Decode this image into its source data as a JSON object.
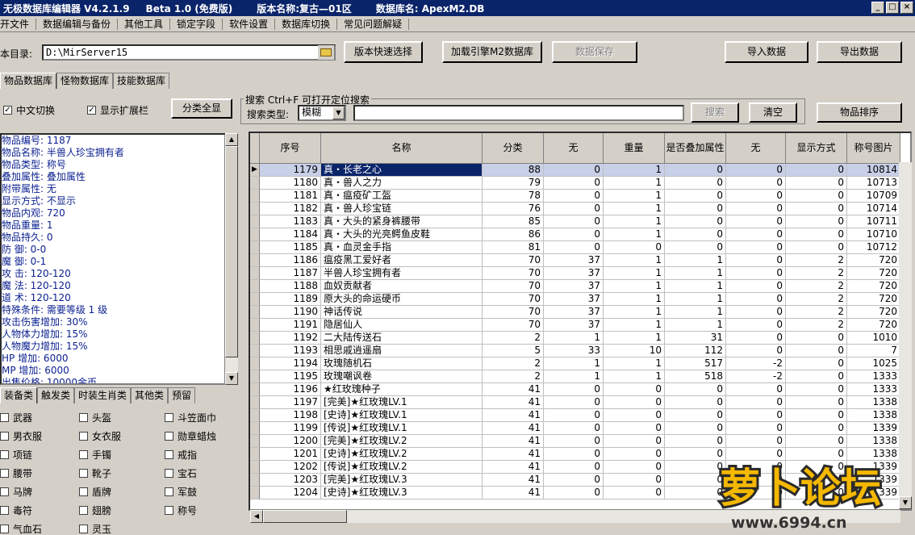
{
  "window": {
    "title_app": "无极数据库编辑器 V4.2.1.9",
    "title_edition": "Beta 1.0 (免费版)",
    "title_version": "版本名称:复古—01区",
    "title_db": "数据库名: ApexM2.DB"
  },
  "menu": [
    "开文件",
    "数据编辑与备份",
    "其他工具",
    "锁定字段",
    "软件设置",
    "数据库切换",
    "常见问题解疑"
  ],
  "toolbar": {
    "path_label": "本目录:",
    "path_value": "D:\\MirServer15",
    "quick_select": "版本快速选择",
    "load_engine": "加载引擎M2数据库",
    "save_data": "数据保存",
    "import": "导入数据",
    "export": "导出数据"
  },
  "tabs": [
    "物品数据库",
    "怪物数据库",
    "技能数据库"
  ],
  "options": {
    "chinese_toggle": "中文切换",
    "show_ext": "显示扩展栏",
    "expand_all": "分类全显"
  },
  "search": {
    "group_label": "搜索  Ctrl+F 可打开定位搜索",
    "type_label": "搜索类型:",
    "type_value": "模糊",
    "search_btn": "搜索",
    "clear_btn": "清空",
    "sort_btn": "物品排序"
  },
  "info_lines": [
    "物品编号: 1187",
    "物品名称: 半兽人珍宝拥有者",
    "物品类型: 称号",
    "叠加属性: 叠加属性",
    "附带属性: 无",
    "显示方式: 不显示",
    "物品内观: 720",
    "物品重量: 1",
    "物品持久: 0",
    "防    御: 0-0",
    "魔    御: 0-1",
    "攻    击: 120-120",
    "魔    法: 120-120",
    "道    术: 120-120",
    "特殊条件: 需要等级 1 级",
    "攻击伤害增加: 30%",
    "人物体力增加: 15%",
    "人物魔力增加: 15%",
    "HP  增加: 6000",
    "MP  增加: 6000",
    "出售价格: 10000金币"
  ],
  "cat_tabs": [
    "装备类",
    "触发类",
    "时装生肖类",
    "其他类",
    "预留"
  ],
  "categories": [
    [
      "武器",
      "头盔",
      "斗笠面巾"
    ],
    [
      "男衣服",
      "女衣服",
      "勋章蜡烛"
    ],
    [
      "项链",
      "手镯",
      "戒指"
    ],
    [
      "腰带",
      "靴子",
      "宝石"
    ],
    [
      "马牌",
      "盾牌",
      "军鼓"
    ],
    [
      "毒符",
      "翅膀",
      "称号"
    ],
    [
      "气血石",
      "灵玉",
      ""
    ]
  ],
  "grid": {
    "headers": [
      "序号",
      "名称",
      "分类",
      "无",
      "重量",
      "是否叠加属性",
      "无",
      "显示方式",
      "称号图片"
    ],
    "rows": [
      [
        "1179",
        "真・长老之心",
        "88",
        "0",
        "1",
        "0",
        "0",
        "0",
        "10814"
      ],
      [
        "1180",
        "真・兽人之力",
        "79",
        "0",
        "1",
        "0",
        "0",
        "0",
        "10713"
      ],
      [
        "1181",
        "真・瘟疫矿工盔",
        "78",
        "0",
        "1",
        "0",
        "0",
        "0",
        "10709"
      ],
      [
        "1182",
        "真・兽人珍宝链",
        "76",
        "0",
        "1",
        "0",
        "0",
        "0",
        "10714"
      ],
      [
        "1183",
        "真・大头的紧身裤腰带",
        "85",
        "0",
        "1",
        "0",
        "0",
        "0",
        "10711"
      ],
      [
        "1184",
        "真・大头的光亮鳄鱼皮鞋",
        "86",
        "0",
        "1",
        "0",
        "0",
        "0",
        "10710"
      ],
      [
        "1185",
        "真・血灵金手指",
        "81",
        "0",
        "0",
        "0",
        "0",
        "0",
        "10712"
      ],
      [
        "1186",
        "瘟疫黑工爱好者",
        "70",
        "37",
        "1",
        "1",
        "0",
        "2",
        "720"
      ],
      [
        "1187",
        "半兽人珍宝拥有者",
        "70",
        "37",
        "1",
        "1",
        "0",
        "2",
        "720"
      ],
      [
        "1188",
        "血奴贡献者",
        "70",
        "37",
        "1",
        "1",
        "0",
        "2",
        "720"
      ],
      [
        "1189",
        "原大头的命运硬币",
        "70",
        "37",
        "1",
        "1",
        "0",
        "2",
        "720"
      ],
      [
        "1190",
        "神话传说",
        "70",
        "37",
        "1",
        "1",
        "0",
        "2",
        "720"
      ],
      [
        "1191",
        "隐居仙人",
        "70",
        "37",
        "1",
        "1",
        "0",
        "2",
        "720"
      ],
      [
        "1192",
        "二大陆传送石",
        "2",
        "1",
        "1",
        "31",
        "0",
        "0",
        "1010"
      ],
      [
        "1193",
        "相思戚逍遥扇",
        "5",
        "33",
        "10",
        "112",
        "0",
        "0",
        "7"
      ],
      [
        "1194",
        "玫瑰随机石",
        "2",
        "1",
        "1",
        "517",
        "-2",
        "0",
        "1025"
      ],
      [
        "1195",
        "玫瑰嘲讽卷",
        "2",
        "1",
        "1",
        "518",
        "-2",
        "0",
        "1333"
      ],
      [
        "1196",
        "★红玫瑰种子",
        "41",
        "0",
        "0",
        "0",
        "0",
        "0",
        "1333"
      ],
      [
        "1197",
        "[完美]★红玫瑰LV.1",
        "41",
        "0",
        "0",
        "0",
        "0",
        "0",
        "1338"
      ],
      [
        "1198",
        "[史诗]★红玫瑰LV.1",
        "41",
        "0",
        "0",
        "0",
        "0",
        "0",
        "1338"
      ],
      [
        "1199",
        "[传说]★红玫瑰LV.1",
        "41",
        "0",
        "0",
        "0",
        "0",
        "0",
        "1339"
      ],
      [
        "1200",
        "[完美]★红玫瑰LV.2",
        "41",
        "0",
        "0",
        "0",
        "0",
        "0",
        "1338"
      ],
      [
        "1201",
        "[史诗]★红玫瑰LV.2",
        "41",
        "0",
        "0",
        "0",
        "0",
        "0",
        "1338"
      ],
      [
        "1202",
        "[传说]★红玫瑰LV.2",
        "41",
        "0",
        "0",
        "0",
        "0",
        "0",
        "1339"
      ],
      [
        "1203",
        "[完美]★红玫瑰LV.3",
        "41",
        "0",
        "0",
        "0",
        "0",
        "0",
        "1339"
      ],
      [
        "1204",
        "[史诗]★红玫瑰LV.3",
        "41",
        "0",
        "0",
        "0",
        "0",
        "0",
        "1339"
      ]
    ]
  },
  "watermark": {
    "logo_text": "萝卜论坛",
    "url": "www.6994.cn"
  }
}
